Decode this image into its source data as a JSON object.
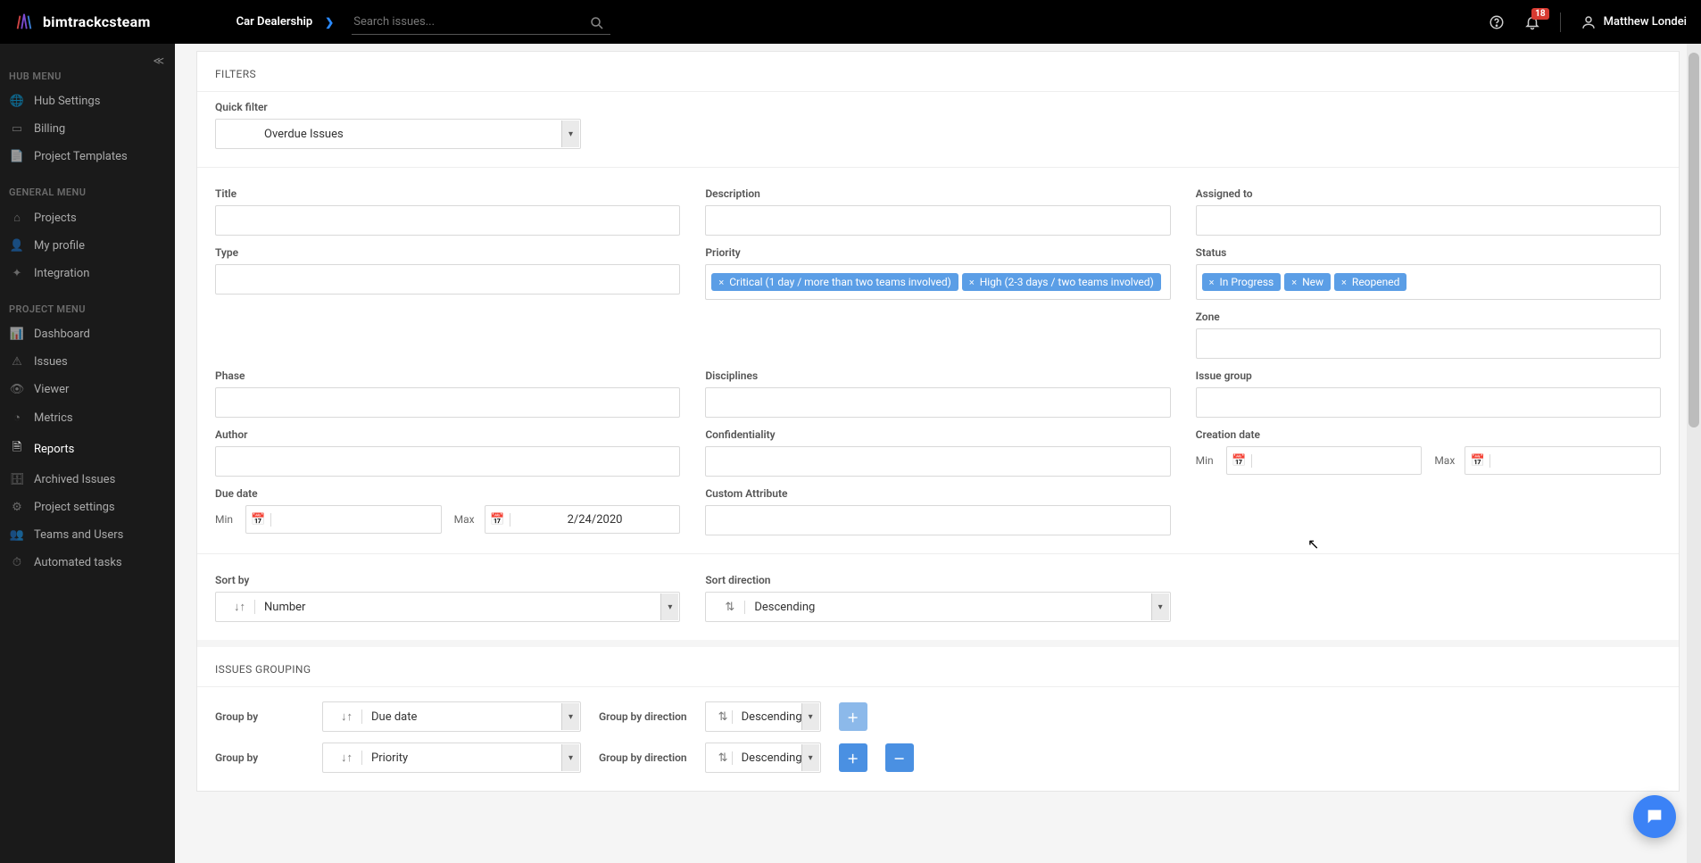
{
  "header": {
    "brand": "bimtrackcsteam",
    "project": "Car Dealership",
    "search_placeholder": "Search issues...",
    "notification_count": "18",
    "user_name": "Matthew Londei"
  },
  "sidebar": {
    "hub_label": "HUB MENU",
    "hub_items": [
      "Hub Settings",
      "Billing",
      "Project Templates"
    ],
    "general_label": "GENERAL MENU",
    "general_items": [
      "Projects",
      "My profile",
      "Integration"
    ],
    "project_label": "PROJECT MENU",
    "project_items": [
      "Dashboard",
      "Issues",
      "Viewer",
      "Metrics",
      "Reports",
      "Archived Issues",
      "Project settings",
      "Teams and Users",
      "Automated tasks"
    ],
    "active_project_item": "Reports"
  },
  "filters": {
    "panel_title": "FILTERS",
    "quick_filter_label": "Quick filter",
    "quick_filter_value": "Overdue Issues",
    "title_label": "Title",
    "description_label": "Description",
    "assigned_to_label": "Assigned to",
    "type_label": "Type",
    "priority_label": "Priority",
    "priority_tags": [
      "Critical (1 day / more than two teams involved)",
      "High (2-3 days / two teams involved)"
    ],
    "status_label": "Status",
    "status_tags": [
      "In Progress",
      "New",
      "Reopened"
    ],
    "zone_label": "Zone",
    "phase_label": "Phase",
    "disciplines_label": "Disciplines",
    "issue_group_label": "Issue group",
    "author_label": "Author",
    "confidentiality_label": "Confidentiality",
    "creation_date_label": "Creation date",
    "due_date_label": "Due date",
    "custom_attr_label": "Custom Attribute",
    "min_label": "Min",
    "max_label": "Max",
    "due_max_value": "2/24/2020",
    "sort_by_label": "Sort by",
    "sort_by_value": "Number",
    "sort_dir_label": "Sort direction",
    "sort_dir_value": "Descending"
  },
  "grouping": {
    "panel_title": "ISSUES GROUPING",
    "group_by_label": "Group by",
    "group_dir_label": "Group by direction",
    "rows": [
      {
        "value": "Due date",
        "direction": "Descending"
      },
      {
        "value": "Priority",
        "direction": "Descending"
      }
    ]
  }
}
